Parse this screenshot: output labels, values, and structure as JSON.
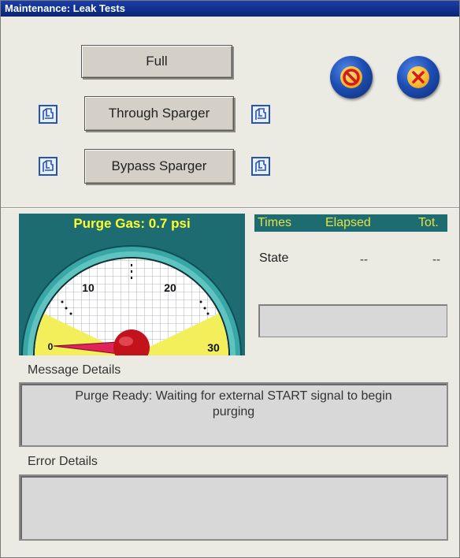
{
  "window": {
    "title": "Maintenance: Leak Tests"
  },
  "tests": {
    "full_label": "Full",
    "through_label": "Through Sparger",
    "bypass_label": "Bypass Sparger"
  },
  "actions": {
    "stop_icon": "stop-no-entry-icon",
    "cancel_icon": "cancel-x-icon"
  },
  "gauge": {
    "title": "Purge Gas: 0.7  psi",
    "value": 0.7,
    "unit": "psi",
    "range": [
      0,
      30
    ],
    "tick_labels": [
      "0",
      "10",
      "20",
      "30"
    ],
    "colors": {
      "panel": "#1c6c72",
      "title": "#ffff30",
      "warn_zone": "#f2ef5a",
      "needle": "#e0245a",
      "hub": "#c2121c"
    }
  },
  "times": {
    "headers": [
      "Times",
      "Elapsed",
      "Tot."
    ],
    "rows": [
      {
        "label": "State",
        "elapsed": "--",
        "total": "--"
      }
    ],
    "status_value": ""
  },
  "message": {
    "label": "Message Details",
    "text_line1": "Purge Ready: Waiting for external START signal to begin",
    "text_line2": "purging"
  },
  "error": {
    "label": "Error Details",
    "text": ""
  }
}
